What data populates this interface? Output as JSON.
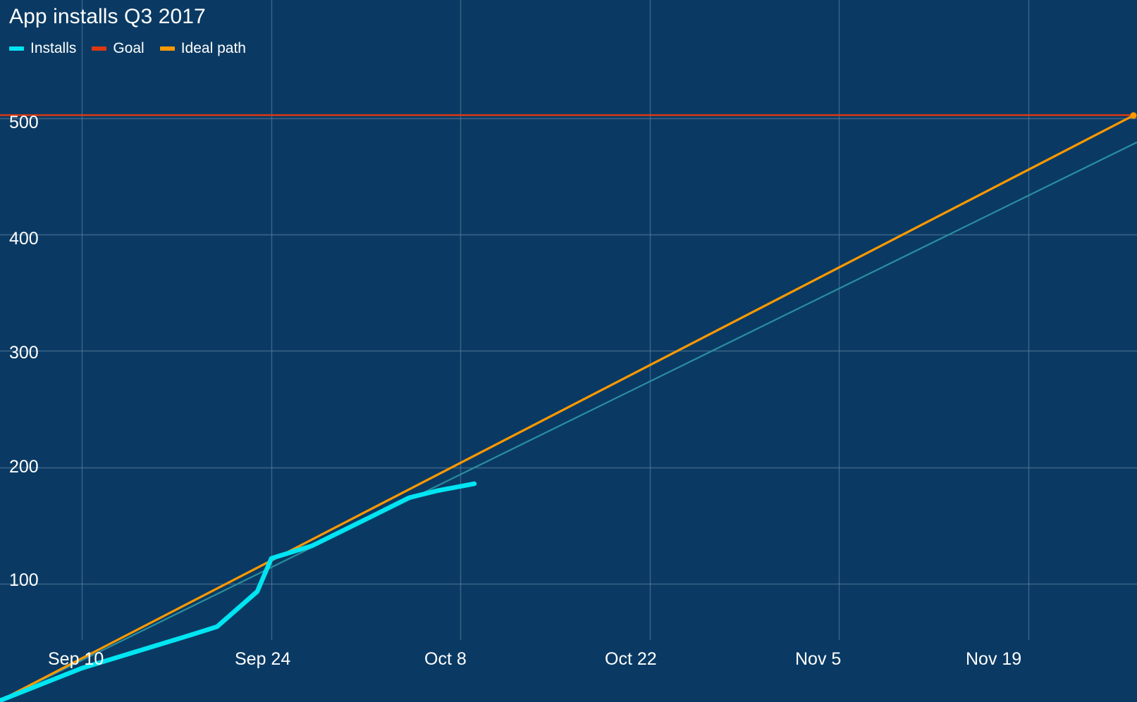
{
  "chart_data": {
    "type": "line",
    "title": "App installs Q3 2017",
    "xlabel": "",
    "ylabel": "",
    "grid": true,
    "legend_position": "top-left",
    "x_tick_labels": [
      "Sep 10",
      "Sep 24",
      "Oct 8",
      "Oct 22",
      "Nov 5",
      "Nov 19"
    ],
    "y_tick_labels": [
      "100",
      "200",
      "300",
      "400",
      "500"
    ],
    "y_ticks": [
      100,
      200,
      300,
      400,
      500
    ],
    "ylim": [
      0,
      560
    ],
    "xlim": [
      "Sep 3",
      "Nov 27"
    ],
    "series": [
      {
        "name": "Installs",
        "color": "#00e5f2",
        "type": "line",
        "x": [
          "Sep 3",
          "Sep 10",
          "Sep 17",
          "Sep 19",
          "Sep 22",
          "Sep 24",
          "Sep 27",
          "Oct 1",
          "Oct 4",
          "Oct 6",
          "Oct 9"
        ],
        "values": [
          0,
          28,
          56,
          62,
          92,
          120,
          131,
          152,
          167,
          178,
          187
        ]
      },
      {
        "name": "Installs trend",
        "color": "#2a8fa0",
        "type": "trendline",
        "x": [
          "Sep 3",
          "Nov 27"
        ],
        "values": [
          0,
          480
        ]
      },
      {
        "name": "Goal",
        "color": "#dc3912",
        "type": "horizontal-line",
        "values": [
          505
        ]
      },
      {
        "name": "Ideal path",
        "color": "#ff9900",
        "type": "line",
        "x": [
          "Sep 3",
          "Nov 27"
        ],
        "values": [
          0,
          505
        ]
      }
    ]
  },
  "chart": {
    "title": "App installs Q3 2017",
    "background_color": "#0a3a63",
    "grid_color": "#5c7e9e",
    "text_color": "#ffffff",
    "legend": [
      {
        "label": "Installs",
        "color": "#00e5f2"
      },
      {
        "label": "Goal",
        "color": "#dc3912"
      },
      {
        "label": "Ideal path",
        "color": "#ff9900"
      }
    ],
    "y_axis": {
      "ticks": [
        {
          "label": "500",
          "value": 500
        },
        {
          "label": "400",
          "value": 400
        },
        {
          "label": "300",
          "value": 300
        },
        {
          "label": "200",
          "value": 200
        },
        {
          "label": "100",
          "value": 100
        }
      ]
    },
    "x_axis": {
      "ticks": [
        {
          "label": "Sep 10"
        },
        {
          "label": "Sep 24"
        },
        {
          "label": "Oct 8"
        },
        {
          "label": "Oct 22"
        },
        {
          "label": "Nov 5"
        },
        {
          "label": "Nov 19"
        }
      ]
    }
  }
}
